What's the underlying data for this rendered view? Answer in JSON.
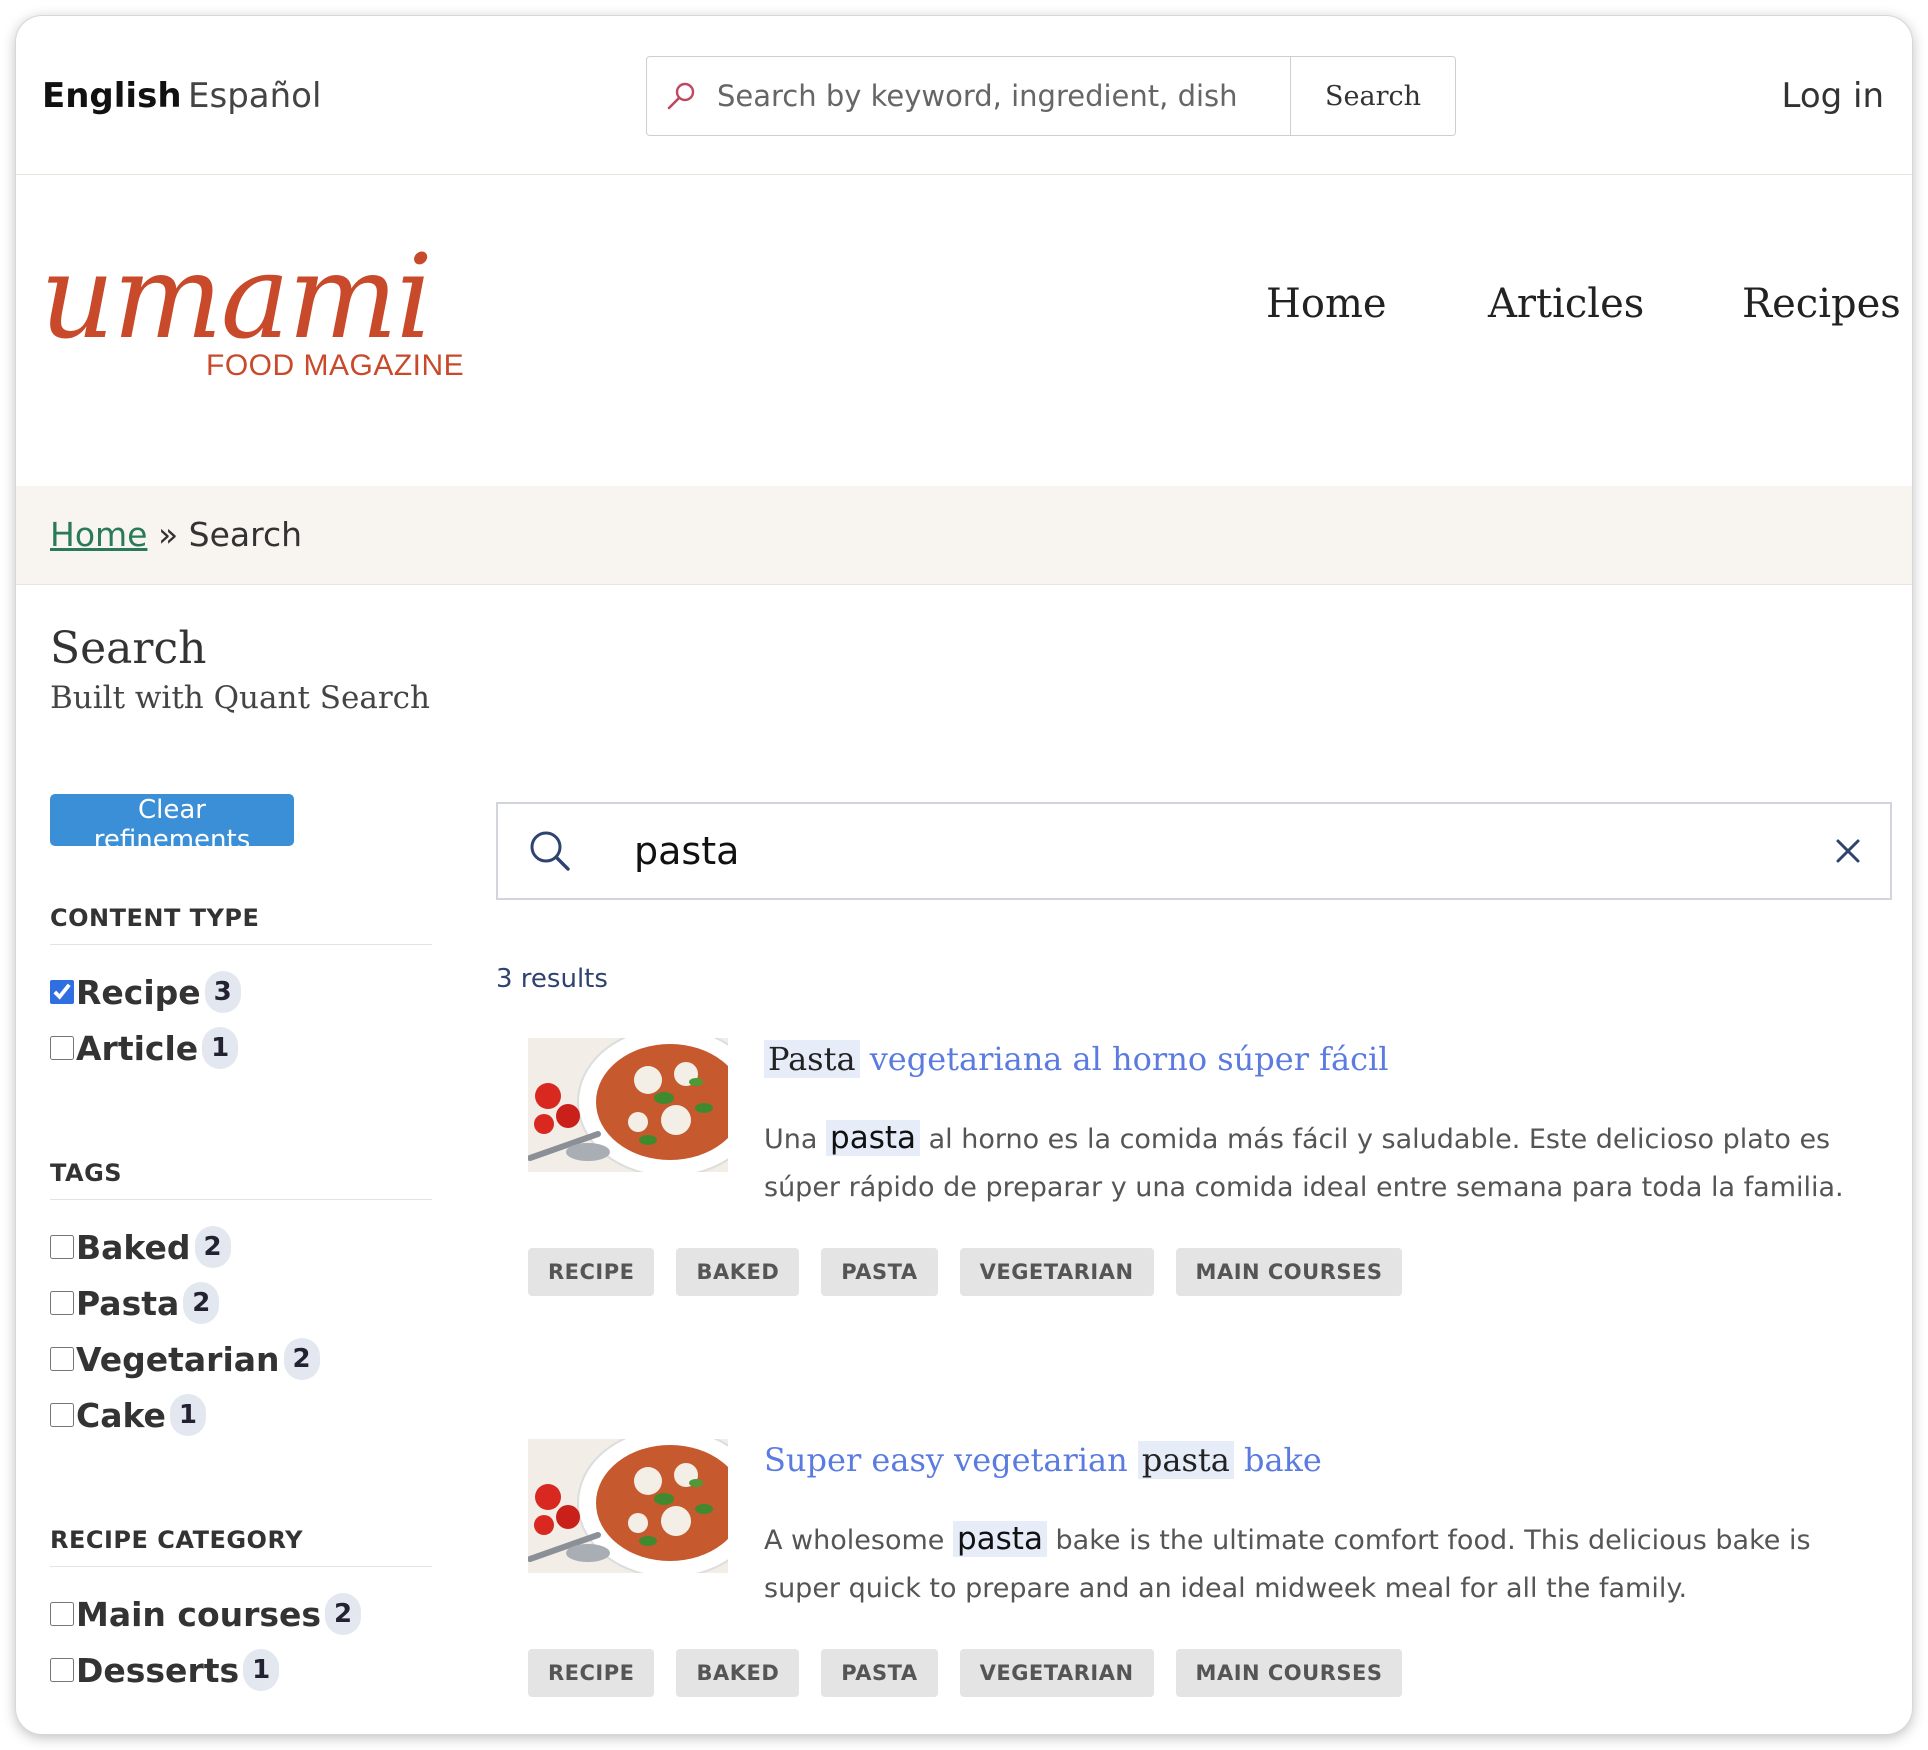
{
  "topbar": {
    "languages": [
      "English",
      "Español"
    ],
    "search_placeholder": "Search by keyword, ingredient, dish",
    "search_button": "Search",
    "login": "Log in"
  },
  "brand": {
    "logo_text": "umami",
    "tagline": "FOOD MAGAZINE",
    "color": "#c94a2b"
  },
  "nav": [
    "Home",
    "Articles",
    "Recipes"
  ],
  "breadcrumb": {
    "home": "Home",
    "separator": "»",
    "current": "Search"
  },
  "page": {
    "title": "Search",
    "subtitle": "Built with Quant Search"
  },
  "sidebar": {
    "clear_button": "Clear refinements",
    "facets": [
      {
        "title": "CONTENT TYPE",
        "items": [
          {
            "label": "Recipe",
            "count": "3",
            "checked": true
          },
          {
            "label": "Article",
            "count": "1",
            "checked": false
          }
        ]
      },
      {
        "title": "TAGS",
        "items": [
          {
            "label": "Baked",
            "count": "2",
            "checked": false
          },
          {
            "label": "Pasta",
            "count": "2",
            "checked": false
          },
          {
            "label": "Vegetarian",
            "count": "2",
            "checked": false
          },
          {
            "label": "Cake",
            "count": "1",
            "checked": false
          }
        ]
      },
      {
        "title": "RECIPE CATEGORY",
        "items": [
          {
            "label": "Main courses",
            "count": "2",
            "checked": false
          },
          {
            "label": "Desserts",
            "count": "1",
            "checked": false
          }
        ]
      }
    ]
  },
  "results": {
    "query": "pasta",
    "count_text": "3 results",
    "hits": [
      {
        "title_pre": "",
        "title_hl": "Pasta",
        "title_post": " vegetariana al horno súper fácil",
        "desc_pre": "Una ",
        "desc_hl": "pasta",
        "desc_post": " al horno es la comida más fácil y saludable. Este delicioso plato es súper rápido de preparar y una comida ideal entre semana para toda la familia.",
        "tags": [
          "RECIPE",
          "BAKED",
          "PASTA",
          "VEGETARIAN",
          "MAIN COURSES"
        ]
      },
      {
        "title_pre": "Super easy vegetarian ",
        "title_hl": "pasta",
        "title_post": " bake",
        "desc_pre": "A wholesome ",
        "desc_hl": "pasta",
        "desc_post": " bake is the ultimate comfort food. This delicious bake is super quick to prepare and an ideal midweek meal for all the family.",
        "tags": [
          "RECIPE",
          "BAKED",
          "PASTA",
          "VEGETARIAN",
          "MAIN COURSES"
        ]
      }
    ]
  },
  "colors": {
    "accent_button": "#3b8fd6",
    "link": "#5b7be0",
    "breadcrumb_link": "#2a7a5a",
    "highlight_bg": "#e6ecf8"
  },
  "icons": [
    "key-search-icon",
    "search-icon",
    "close-icon"
  ]
}
